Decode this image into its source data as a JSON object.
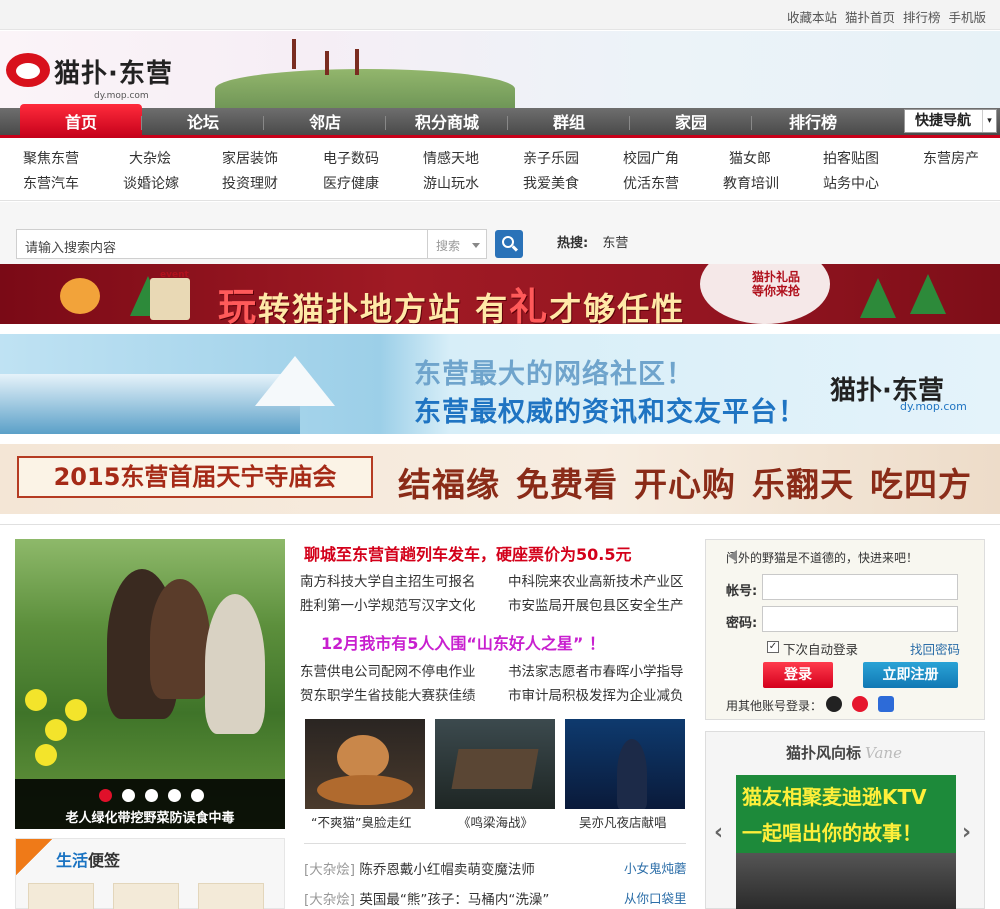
{
  "topbar": {
    "links": [
      "收藏本站",
      "猫扑首页",
      "排行榜",
      "手机版"
    ]
  },
  "logo": {
    "name": "猫扑·东营",
    "url": "dy.mop.com"
  },
  "nav": {
    "items": [
      "首页",
      "论坛",
      "邻店",
      "积分商城",
      "群组",
      "家园",
      "排行榜"
    ],
    "quick_label": "快捷导航",
    "quick_arrow": "▾"
  },
  "subnav": {
    "row1": [
      "聚焦东营",
      "大杂烩",
      "家居装饰",
      "电子数码",
      "情感天地",
      "亲子乐园",
      "校园广角",
      "猫女郎",
      "拍客贴图",
      "东营房产"
    ],
    "row2": [
      "东营汽车",
      "谈婚论嫁",
      "投资理财",
      "医疗健康",
      "游山玩水",
      "我爱美食",
      "优活东营",
      "教育培训",
      "站务中心"
    ]
  },
  "search": {
    "placeholder": "请输入搜索内容",
    "type": "搜索",
    "hot_label": "热搜:",
    "hot_term": "东营"
  },
  "banner1": {
    "prefix_big": "玩",
    "text1": "转猫扑地方站 有",
    "big2": "礼",
    "text2": "才够任性",
    "gift_line1": "猫扑礼品",
    "gift_line2": "等你来抢",
    "event": "event"
  },
  "banner2": {
    "line1": "东营最大的网络社区！",
    "line2": "东营最权威的资讯和交友平台！",
    "logo": "猫扑·东营",
    "url": "dy.mop.com"
  },
  "banner3": {
    "box": "2015东营首届天宁寺庙会",
    "slogans": [
      "结福缘",
      "免费看",
      "开心购",
      "乐翻天",
      "吃四方"
    ]
  },
  "slideshow": {
    "caption": "老人绿化带挖野菜防误食中毒",
    "active_index": 0,
    "dot_count": 5
  },
  "news": {
    "headline1": "聊城至东营首趟列车发车，硬座票价为50.5元",
    "group1": [
      [
        "南方科技大学自主招生可报名",
        "中科院来农业高新技术产业区"
      ],
      [
        "胜利第一小学规范写汉字文化",
        "市安监局开展包县区安全生产"
      ]
    ],
    "headline2": "12月我市有5人入围“山东好人之星”  ！",
    "group2": [
      [
        "东营供电公司配网不停电作业",
        "书法家志愿者市春晖小学指导"
      ],
      [
        "贺东职学生省技能大赛获佳绩",
        "市审计局积极发挥为企业减负"
      ]
    ]
  },
  "thumbs": [
    {
      "caption": "“不爽猫”臭脸走红"
    },
    {
      "caption": "《鸣梁海战》"
    },
    {
      "caption": "吴亦凡夜店献唱"
    }
  ],
  "list": [
    {
      "cat": "[大杂烩]",
      "title": "陈乔恩戴小红帽卖萌变魔法师",
      "right": "小女鬼炖蘑"
    },
    {
      "cat": "[大杂烩]",
      "title": "英国最“熊”孩子：马桶内“洗澡”",
      "right": "从你口袋里"
    }
  ],
  "life": {
    "title_a": "生活",
    "title_b": "便签"
  },
  "login": {
    "note": "门外的野猫是不道德的，快进来吧！",
    "user_label": "帐号:",
    "pass_label": "密码:",
    "remember": "下次自动登录",
    "remember_checked": true,
    "checkmark": "✓",
    "forgot": "找回密码",
    "login_btn": "登录",
    "register_btn": "立即注册",
    "other": "用其他账号登录："
  },
  "vane": {
    "title": "猫扑风向标",
    "title_en": "Vane",
    "line1": "猫友相聚麦迪逊KTV",
    "line2": "一起唱出你的故事！",
    "prev": "‹",
    "next": "›"
  },
  "colors": {
    "brand_red": "#c8001a",
    "link_blue": "#2c6ea8",
    "nav_gray": "#555555",
    "headline_red": "#d3001a",
    "headline_purple": "#c81fcf"
  }
}
